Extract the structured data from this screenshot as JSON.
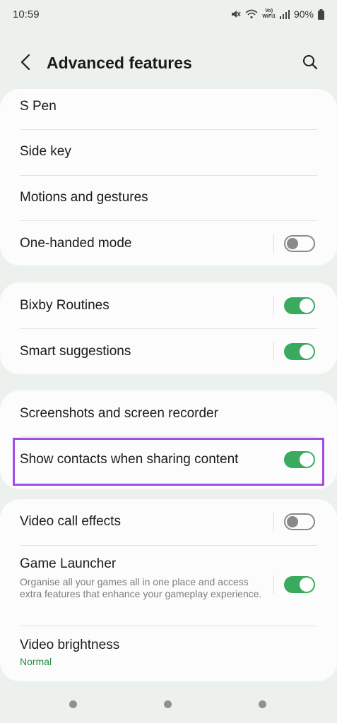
{
  "status_bar": {
    "time": "10:59",
    "battery": "90%",
    "volte_line1": "Vo)",
    "volte_line2": "WiFi1"
  },
  "header": {
    "title": "Advanced features"
  },
  "groups": [
    {
      "items": [
        {
          "label": "S Pen"
        },
        {
          "label": "Side key"
        },
        {
          "label": "Motions and gestures"
        },
        {
          "label": "One-handed mode",
          "toggle": false
        }
      ]
    },
    {
      "items": [
        {
          "label": "Bixby Routines",
          "toggle": true
        },
        {
          "label": "Smart suggestions",
          "toggle": true
        }
      ]
    },
    {
      "items": [
        {
          "label": "Screenshots and screen recorder"
        },
        {
          "label": "Show contacts when sharing content",
          "toggle": true
        }
      ]
    },
    {
      "items": [
        {
          "label": "Video call effects",
          "toggle": false
        },
        {
          "label": "Game Launcher",
          "description": "Organise all your games all in one place and access extra features that enhance your gameplay experience.",
          "toggle": true
        },
        {
          "label": "Video brightness",
          "sublabel": "Normal"
        }
      ]
    }
  ],
  "colors": {
    "accent_green": "#3aaa5e",
    "highlight": "#a24ce8",
    "sublabel": "#2e8b4a"
  },
  "icons": {
    "back": "back-arrow-icon",
    "search": "search-icon"
  }
}
